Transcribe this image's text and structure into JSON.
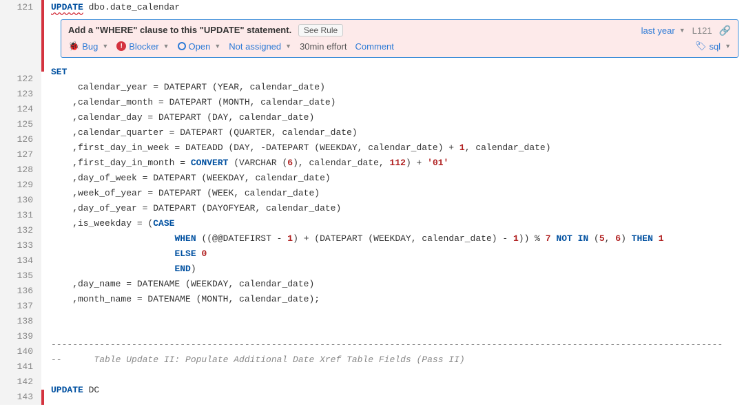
{
  "gutter": {
    "first": "121",
    "rest": [
      "122",
      "123",
      "124",
      "125",
      "126",
      "127",
      "128",
      "129",
      "130",
      "131",
      "132",
      "133",
      "134",
      "135",
      "136",
      "137",
      "138",
      "139",
      "140",
      "141",
      "142",
      "143"
    ]
  },
  "issue": {
    "title": "Add a \"WHERE\" clause to this \"UPDATE\" statement.",
    "see_rule": "See Rule",
    "age": "last year",
    "location": "L121",
    "type": "Bug",
    "severity": "Blocker",
    "status": "Open",
    "assignee": "Not assigned",
    "effort": "30min effort",
    "comment": "Comment",
    "tag": "sql"
  },
  "code": {
    "l121_kw": "UPDATE",
    "l121_rest": " dbo.date_calendar",
    "l122": "SET",
    "l123": "     calendar_year = DATEPART (YEAR, calendar_date)",
    "l124": "    ,calendar_month = DATEPART (MONTH, calendar_date)",
    "l125": "    ,calendar_day = DATEPART (DAY, calendar_date)",
    "l126": "    ,calendar_quarter = DATEPART (QUARTER, calendar_date)",
    "l127a": "    ,first_day_in_week = DATEADD (DAY, -DATEPART (WEEKDAY, calendar_date) + ",
    "l127n": "1",
    "l127b": ", calendar_date)",
    "l128a": "    ,first_day_in_month = ",
    "l128kw": "CONVERT",
    "l128b": " (VARCHAR (",
    "l128n1": "6",
    "l128c": "), calendar_date, ",
    "l128n2": "112",
    "l128d": ") + ",
    "l128s": "'01'",
    "l129": "    ,day_of_week = DATEPART (WEEKDAY, calendar_date)",
    "l130": "    ,week_of_year = DATEPART (WEEK, calendar_date)",
    "l131": "    ,day_of_year = DATEPART (DAYOFYEAR, calendar_date)",
    "l132a": "    ,is_weekday = (",
    "l132kw": "CASE",
    "l133pad": "                       ",
    "l133kw1": "WHEN",
    "l133a": " ((@@DATEFIRST - ",
    "l133n1": "1",
    "l133b": ") + (DATEPART (WEEKDAY, calendar_date) - ",
    "l133n2": "1",
    "l133c": ")) % ",
    "l133n3": "7",
    "l133kw2": " NOT IN ",
    "l133d": "(",
    "l133n4": "5",
    "l133e": ", ",
    "l133n5": "6",
    "l133f": ") ",
    "l133kw3": "THEN",
    "l133g": " ",
    "l133n6": "1",
    "l134pad": "                       ",
    "l134kw": "ELSE",
    "l134n": " 0",
    "l135pad": "                       ",
    "l135kw": "END",
    "l135b": ")",
    "l136": "    ,day_name = DATENAME (WEEKDAY, calendar_date)",
    "l137": "    ,month_name = DATENAME (MONTH, calendar_date);",
    "l140": "-----------------------------------------------------------------------------------------------------------------------------",
    "l141": "--      Table Update II: Populate Additional Date Xref Table Fields (Pass II)",
    "l142": "",
    "l143kw": "UPDATE",
    "l143b": " DC"
  }
}
